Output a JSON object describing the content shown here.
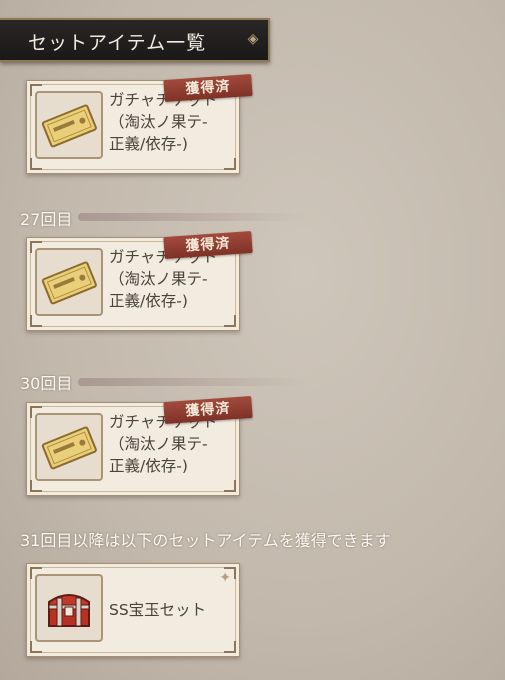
{
  "header": {
    "title": "セットアイテム一覧",
    "ornament_icon": "diamond-ornament-icon"
  },
  "sections": [
    {
      "label": "",
      "item": {
        "name": "ガチャチケット\n（淘汰ノ果テ-\n正義/依存-)",
        "badge": "獲得済",
        "icon": "ticket-icon"
      }
    },
    {
      "label": "27回目",
      "item": {
        "name": "ガチャチケット\n（淘汰ノ果テ-\n正義/依存-)",
        "badge": "獲得済",
        "icon": "ticket-icon"
      }
    },
    {
      "label": "30回目",
      "item": {
        "name": "ガチャチケット\n（淘汰ノ果テ-\n正義/依存-)",
        "badge": "獲得済",
        "icon": "ticket-icon"
      }
    }
  ],
  "after": {
    "label": "31回目以降は以下のセットアイテムを獲得できます",
    "item": {
      "name": "SS宝玉セット",
      "icon": "treasure-chest-icon"
    }
  },
  "colors": {
    "badge": "#8f3c30",
    "header_bg": "#221f1f",
    "card_bg": "#f1ebe0"
  }
}
